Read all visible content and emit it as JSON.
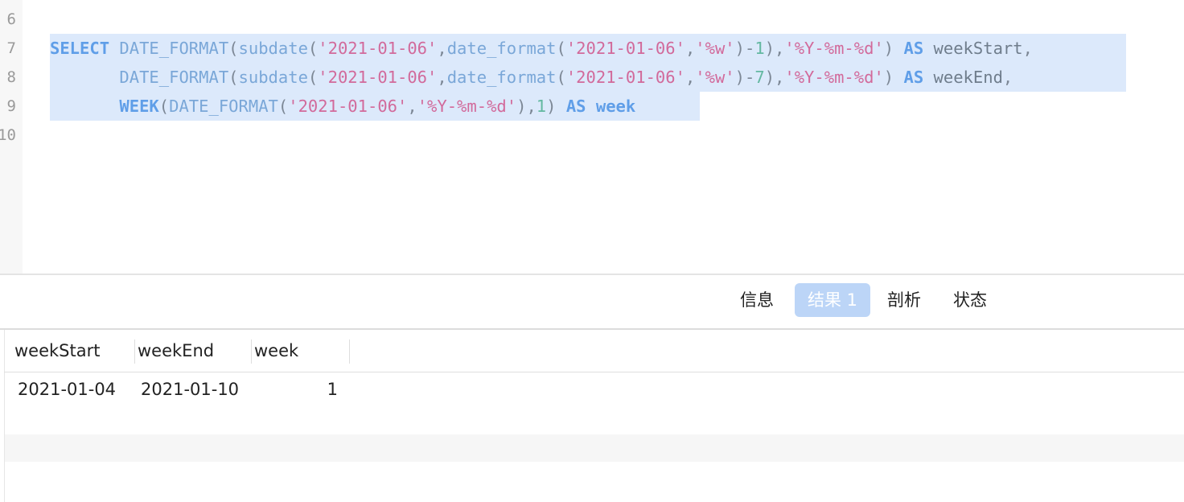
{
  "editor": {
    "line_numbers": [
      "6",
      "7",
      "8",
      "9",
      "10"
    ],
    "sql": {
      "select_kw": "SELECT",
      "date_format_fn": "DATE_FORMAT",
      "subdate_fn": "subdate",
      "date_format_lower_fn": "date_format",
      "week_fn": "WEEK",
      "as_kw": "AS",
      "date_str": "'2021-01-06'",
      "w_str": "'%w'",
      "ymd_str": "'%Y-%m-%d'",
      "num_1": "1",
      "num_7": "7",
      "alias_week_start": "weekStart",
      "alias_week_end": "weekEnd",
      "alias_week": "week"
    }
  },
  "tabs": [
    {
      "label": "信息"
    },
    {
      "label": "结果 1",
      "active": true
    },
    {
      "label": "剖析"
    },
    {
      "label": "状态"
    }
  ],
  "results": {
    "columns": [
      "weekStart",
      "weekEnd",
      "week"
    ],
    "rows": [
      [
        "2021-01-04",
        "2021-01-10",
        "1"
      ]
    ]
  },
  "colors": {
    "selection": "#dce9fb",
    "keyword": "#5f9ee8",
    "string": "#d26a9b",
    "number": "#63b8a1",
    "active_tab": "#bcd5f7"
  }
}
